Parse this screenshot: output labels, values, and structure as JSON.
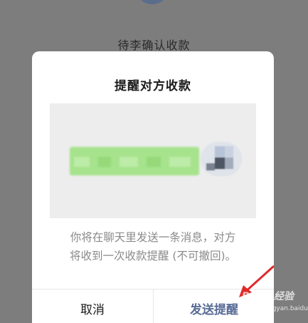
{
  "background": {
    "status_text": "待李确认收款"
  },
  "dialog": {
    "title": "提醒对方收款",
    "message_line1": "你将在聊天里发送一条消息，对方",
    "message_line2": "将收到一次收款提醒 (不可撤回)。",
    "cancel_label": "取消",
    "send_label": "发送提醒"
  },
  "watermark": {
    "brand": "Baidu经验",
    "url": "jingyan.baidu.com"
  },
  "colors": {
    "overlay": "#7d7d7d",
    "dialog_bg": "#ffffff",
    "preview_bg": "#ededed",
    "bubble_green": "#a6e38c",
    "send_blue": "#576b95",
    "message_gray": "#8a8a8a",
    "arrow_red": "#e02a2a"
  },
  "icons": {
    "arrow": "red-pointer-arrow-icon",
    "avatar": "user-avatar-icon"
  }
}
